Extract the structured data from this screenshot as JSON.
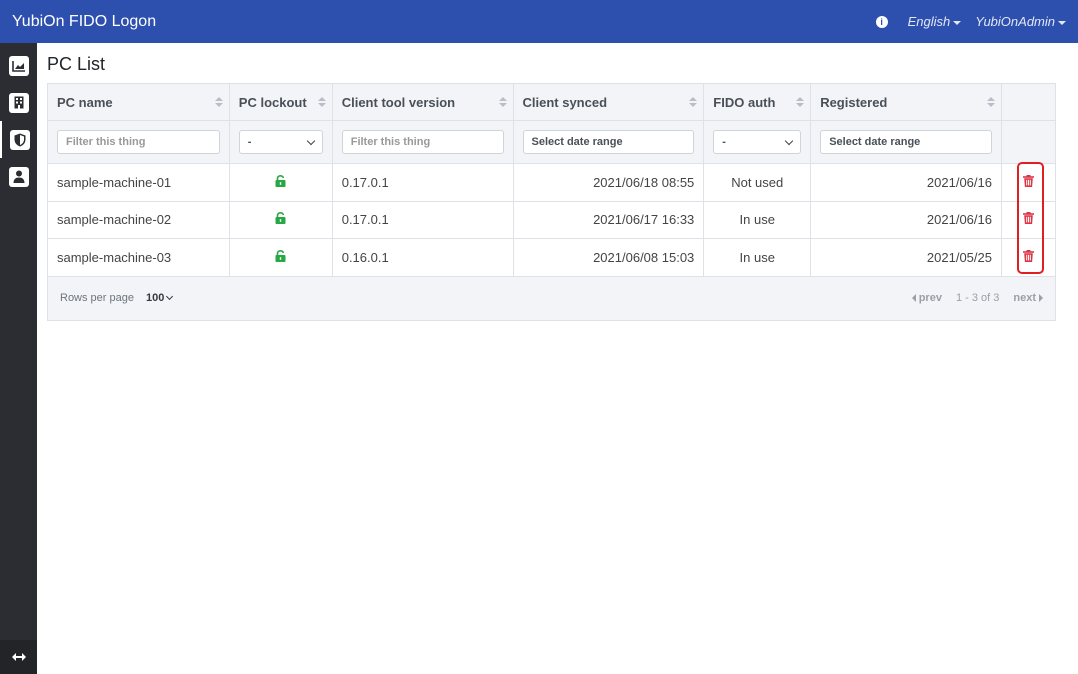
{
  "app": {
    "title": "YubiOn FIDO Logon"
  },
  "nav": {
    "language": "English",
    "user": "YubiOnAdmin"
  },
  "page": {
    "title": "PC List"
  },
  "table": {
    "columns": [
      "PC name",
      "PC lockout",
      "Client tool version",
      "Client synced",
      "FIDO auth",
      "Registered"
    ],
    "filters": {
      "pc_name_placeholder": "Filter this thing",
      "lockout_value": "-",
      "version_placeholder": "Filter this thing",
      "synced_placeholder": "Select date range",
      "fido_value": "-",
      "registered_placeholder": "Select date range"
    },
    "rows": [
      {
        "pc_name": "sample-machine-01",
        "version": "0.17.0.1",
        "synced": "2021/06/18 08:55",
        "fido": "Not used",
        "registered": "2021/06/16"
      },
      {
        "pc_name": "sample-machine-02",
        "version": "0.17.0.1",
        "synced": "2021/06/17 16:33",
        "fido": "In use",
        "registered": "2021/06/16"
      },
      {
        "pc_name": "sample-machine-03",
        "version": "0.16.0.1",
        "synced": "2021/06/08 15:03",
        "fido": "In use",
        "registered": "2021/05/25"
      }
    ]
  },
  "footer": {
    "rows_per_page_label": "Rows per page",
    "rows_per_page_value": "100",
    "prev": "prev",
    "range": "1 - 3 of 3",
    "next": "next"
  },
  "colors": {
    "navbar": "#2d4fae",
    "sidebar": "#2b2d33",
    "unlock": "#28a745",
    "delete": "#dc3545",
    "highlight": "#e02020"
  },
  "icons": [
    "info-icon",
    "chart-icon",
    "building-icon",
    "shield-icon",
    "user-icon",
    "expand-arrows-icon",
    "unlock-icon",
    "trash-icon"
  ]
}
